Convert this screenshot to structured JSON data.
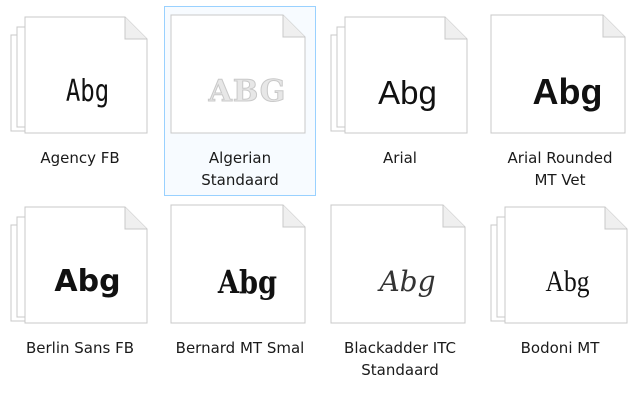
{
  "items": [
    {
      "label_line1": "Agency FB",
      "label_line2": "",
      "sample": "Abg",
      "stacked": true,
      "selected": false
    },
    {
      "label_line1": "Algerian",
      "label_line2": "Standaard",
      "sample": "ABG",
      "stacked": false,
      "selected": true
    },
    {
      "label_line1": "Arial",
      "label_line2": "",
      "sample": "Abg",
      "stacked": true,
      "selected": false
    },
    {
      "label_line1": "Arial Rounded",
      "label_line2": "MT Vet",
      "sample": "Abg",
      "stacked": false,
      "selected": false
    },
    {
      "label_line1": "Berlin Sans FB",
      "label_line2": "",
      "sample": "Abg",
      "stacked": true,
      "selected": false
    },
    {
      "label_line1": "Bernard MT Smal",
      "label_line2": "",
      "sample": "Abg",
      "stacked": false,
      "selected": false
    },
    {
      "label_line1": "Blackadder ITC",
      "label_line2": "Standaard",
      "sample": "Abg",
      "stacked": false,
      "selected": false
    },
    {
      "label_line1": "Bodoni MT",
      "label_line2": "",
      "sample": "Abg",
      "stacked": true,
      "selected": false
    }
  ],
  "colors": {
    "selection_border": "#99d1ff",
    "page_fill": "#ffffff",
    "page_border": "#c8c8c8"
  }
}
